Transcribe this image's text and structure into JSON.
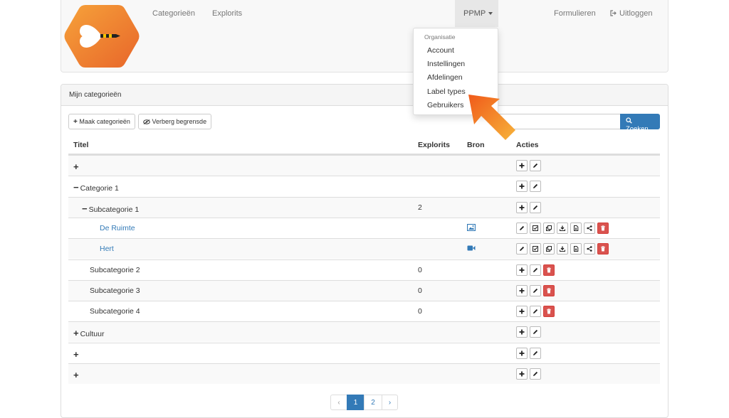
{
  "navbar": {
    "links": {
      "categorieen": "Categorieën",
      "explorits": "Explorits",
      "ppmp": "PPMP",
      "formulieren": "Formulieren",
      "uitloggen": "Uitloggen"
    }
  },
  "dropdown": {
    "header": "Organisatie",
    "items": [
      "Account",
      "Instellingen",
      "Afdelingen",
      "Label types",
      "Gebruikers"
    ]
  },
  "panel": {
    "title": "Mijn categorieën",
    "buttons": {
      "create": "Maak categorieën",
      "hide": "Verberg begrensde"
    },
    "search": {
      "placeholder": "",
      "button": "Zoeken"
    }
  },
  "table": {
    "headers": {
      "title": "Titel",
      "explorits": "Explorits",
      "source": "Bron",
      "actions": "Acties"
    },
    "rows": [
      {
        "symbol": "+",
        "title": "",
        "explorits": "",
        "source": "",
        "actions": [
          "add",
          "edit"
        ]
      },
      {
        "symbol": "−",
        "title": "Categorie 1",
        "explorits": "",
        "source": "",
        "actions": [
          "add",
          "edit"
        ]
      },
      {
        "symbol": "−",
        "title": "Subcategorie 1",
        "explorits": "2",
        "source": "",
        "actions": [
          "add",
          "edit"
        ]
      },
      {
        "symbol": "",
        "title": "De Ruimte",
        "explorits": "",
        "source": "image-icon",
        "actions": [
          "edit",
          "check",
          "copy",
          "download",
          "file",
          "share",
          "delete"
        ]
      },
      {
        "symbol": "",
        "title": "Hert",
        "explorits": "",
        "source": "video-icon",
        "actions": [
          "edit",
          "check",
          "copy",
          "download",
          "file",
          "share",
          "delete"
        ]
      },
      {
        "symbol": "",
        "title": "Subcategorie 2",
        "explorits": "0",
        "source": "",
        "actions": [
          "add",
          "edit",
          "delete"
        ]
      },
      {
        "symbol": "",
        "title": "Subcategorie 3",
        "explorits": "0",
        "source": "",
        "actions": [
          "add",
          "edit",
          "delete"
        ]
      },
      {
        "symbol": "",
        "title": "Subcategorie 4",
        "explorits": "0",
        "source": "",
        "actions": [
          "add",
          "edit",
          "delete"
        ]
      },
      {
        "symbol": "+",
        "title": "Cultuur",
        "explorits": "",
        "source": "",
        "actions": [
          "add",
          "edit"
        ]
      },
      {
        "symbol": "+",
        "title": "",
        "explorits": "",
        "source": "",
        "actions": [
          "add",
          "edit"
        ]
      },
      {
        "symbol": "+",
        "title": "",
        "explorits": "",
        "source": "",
        "actions": [
          "add",
          "edit"
        ]
      }
    ]
  },
  "pagination": {
    "prev": "‹",
    "pages": [
      "1",
      "2"
    ],
    "next": "›",
    "active": "1"
  },
  "colors": {
    "accent": "#337ab7",
    "danger": "#d9534f",
    "arrow": "#f7931e",
    "logo": "#ef7d21"
  }
}
